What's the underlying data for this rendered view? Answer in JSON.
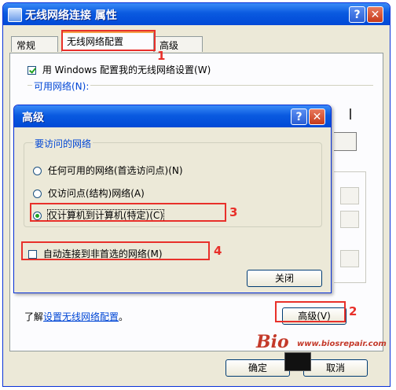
{
  "main_window": {
    "title": "无线网络连接 属性",
    "help_glyph": "?",
    "close_glyph": "✕",
    "tabs": [
      {
        "label": "常规",
        "active": false
      },
      {
        "label": "无线网络配置",
        "active": true
      },
      {
        "label": "高级",
        "active": false
      }
    ],
    "use_windows_checkbox": {
      "label": "用 Windows 配置我的无线网络设置(W)",
      "checked": true
    },
    "available_networks_label": "可用网络(N):",
    "learn_prefix": "了解",
    "learn_link": "设置无线网络配置",
    "learn_suffix": "。",
    "advanced_button": "高级(V)",
    "ok_button": "确定",
    "cancel_button": "取消"
  },
  "advanced_dialog": {
    "title": "高级",
    "help_glyph": "?",
    "close_glyph": "✕",
    "group_title": "要访问的网络",
    "options": [
      {
        "label": "任何可用的网络(首选访问点)(N)",
        "selected": false
      },
      {
        "label": "仅访问点(结构)网络(A)",
        "selected": false
      },
      {
        "label": "仅计算机到计算机(特定)(C)",
        "selected": true
      }
    ],
    "auto_connect_checkbox": {
      "label": "自动连接到非首选的网络(M)",
      "checked": false
    },
    "close_button": "关闭"
  },
  "annotations": {
    "markers": [
      "1",
      "2",
      "3",
      "4"
    ],
    "color": "#e8302a"
  },
  "watermark": {
    "url": "www.biosrepair.com"
  },
  "colors": {
    "titlebar": "#0a5ae0",
    "window_face": "#ece9d8",
    "link": "#0046d5",
    "active_tab_accent": "#f3a34a"
  }
}
